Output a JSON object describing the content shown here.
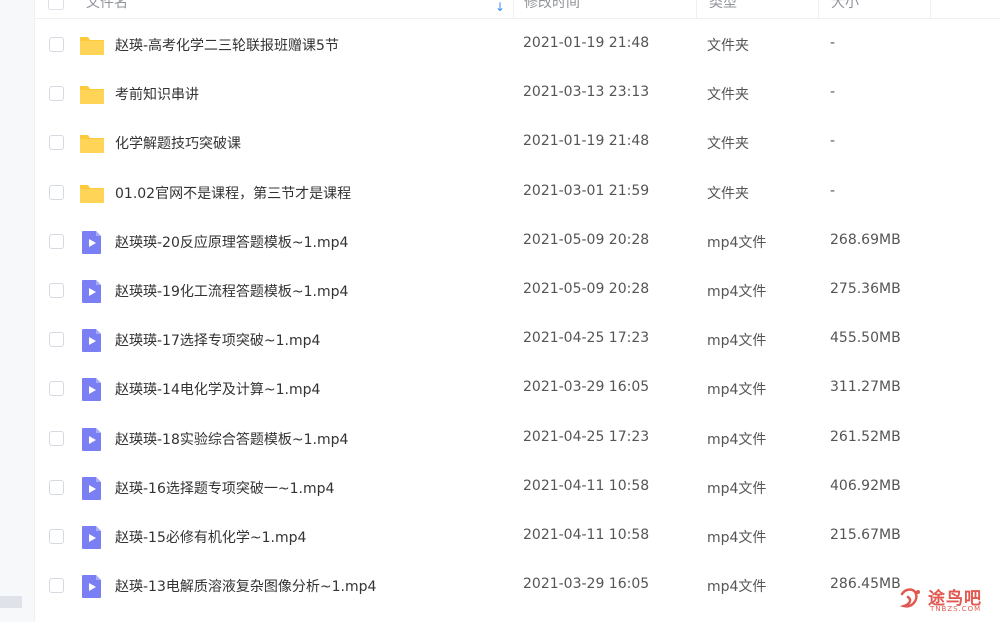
{
  "header": {
    "name_col": "文件名",
    "mtime_col": "修改时间",
    "type_col": "类型",
    "size_col": "大小",
    "sort_indicator": "↓"
  },
  "files": [
    {
      "icon": "folder-icon",
      "name": "赵瑛-高考化学二三轮联报班赠课5节",
      "mtime": "2021-01-19 21:48",
      "type": "文件夹",
      "size": "-"
    },
    {
      "icon": "folder-icon",
      "name": "考前知识串讲",
      "mtime": "2021-03-13 23:13",
      "type": "文件夹",
      "size": "-"
    },
    {
      "icon": "folder-icon",
      "name": "化学解题技巧突破课",
      "mtime": "2021-01-19 21:48",
      "type": "文件夹",
      "size": "-"
    },
    {
      "icon": "folder-icon",
      "name": "01.02官网不是课程，第三节才是课程",
      "mtime": "2021-03-01 21:59",
      "type": "文件夹",
      "size": "-"
    },
    {
      "icon": "video-file-icon",
      "name": "赵瑛瑛-20反应原理答题模板~1.mp4",
      "mtime": "2021-05-09 20:28",
      "type": "mp4文件",
      "size": "268.69MB"
    },
    {
      "icon": "video-file-icon",
      "name": "赵瑛瑛-19化工流程答题模板~1.mp4",
      "mtime": "2021-05-09 20:28",
      "type": "mp4文件",
      "size": "275.36MB"
    },
    {
      "icon": "video-file-icon",
      "name": "赵瑛瑛-17选择专项突破~1.mp4",
      "mtime": "2021-04-25 17:23",
      "type": "mp4文件",
      "size": "455.50MB"
    },
    {
      "icon": "video-file-icon",
      "name": "赵瑛瑛-14电化学及计算~1.mp4",
      "mtime": "2021-03-29 16:05",
      "type": "mp4文件",
      "size": "311.27MB"
    },
    {
      "icon": "video-file-icon",
      "name": "赵瑛瑛-18实验综合答题模板~1.mp4",
      "mtime": "2021-04-25 17:23",
      "type": "mp4文件",
      "size": "261.52MB"
    },
    {
      "icon": "video-file-icon",
      "name": "赵瑛-16选择题专项突破一~1.mp4",
      "mtime": "2021-04-11 10:58",
      "type": "mp4文件",
      "size": "406.92MB"
    },
    {
      "icon": "video-file-icon",
      "name": "赵瑛-15必修有机化学~1.mp4",
      "mtime": "2021-04-11 10:58",
      "type": "mp4文件",
      "size": "215.67MB"
    },
    {
      "icon": "video-file-icon",
      "name": "赵瑛-13电解质溶液复杂图像分析~1.mp4",
      "mtime": "2021-03-29 16:05",
      "type": "mp4文件",
      "size": "286.45MB"
    }
  ],
  "watermark": {
    "text": "途鸟吧",
    "sub": "TNBZS.COM"
  },
  "colors": {
    "folder": "#ffc93c",
    "video": "#7b7ff4",
    "sort_accent": "#3c8cff"
  }
}
